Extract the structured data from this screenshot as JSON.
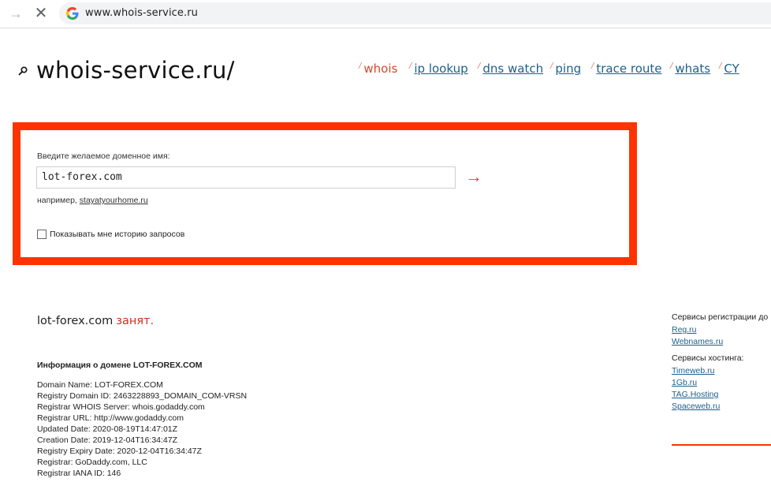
{
  "browser": {
    "url": "www.whois-service.ru"
  },
  "site": {
    "logo": "whois-service.ru/"
  },
  "nav": [
    {
      "label": "whois",
      "active": true
    },
    {
      "label": "ip lookup"
    },
    {
      "label": "dns watch"
    },
    {
      "label": "ping"
    },
    {
      "label": "trace route"
    },
    {
      "label": "whats"
    },
    {
      "label": "CY"
    }
  ],
  "form": {
    "label": "Введите желаемое доменное имя:",
    "value": "lot-forex.com",
    "submit": "→",
    "example_prefix": "например,",
    "example_link": "stayatyourhome.ru",
    "history_label": "Показывать мне историю запросов"
  },
  "result": {
    "domain": "lot-forex.com",
    "status": "занят.",
    "info_heading": "Информация о домене LOT-FOREX.COM",
    "lines": [
      "Domain Name: LOT-FOREX.COM",
      "Registry Domain ID: 2463228893_DOMAIN_COM-VRSN",
      "Registrar WHOIS Server: whois.godaddy.com",
      "Registrar URL: http://www.godaddy.com",
      "Updated Date: 2020-08-19T14:47:01Z",
      "Creation Date: 2019-12-04T16:34:47Z",
      "Registry Expiry Date: 2020-12-04T16:34:47Z",
      "Registrar: GoDaddy.com, LLC",
      "Registrar IANA ID: 146"
    ]
  },
  "sidebar": {
    "registration_title": "Сервисы регистрации до",
    "registration_links": [
      "Reg.ru",
      "Webnames.ru"
    ],
    "hosting_title": "Сервисы хостинга:",
    "hosting_links": [
      "Timeweb.ru",
      "1Gb.ru",
      "TAG.Hosting",
      "Spaceweb.ru"
    ]
  },
  "colors": {
    "accent": "#ff3300",
    "link": "#1d5f8a",
    "busy": "#c8321c"
  }
}
